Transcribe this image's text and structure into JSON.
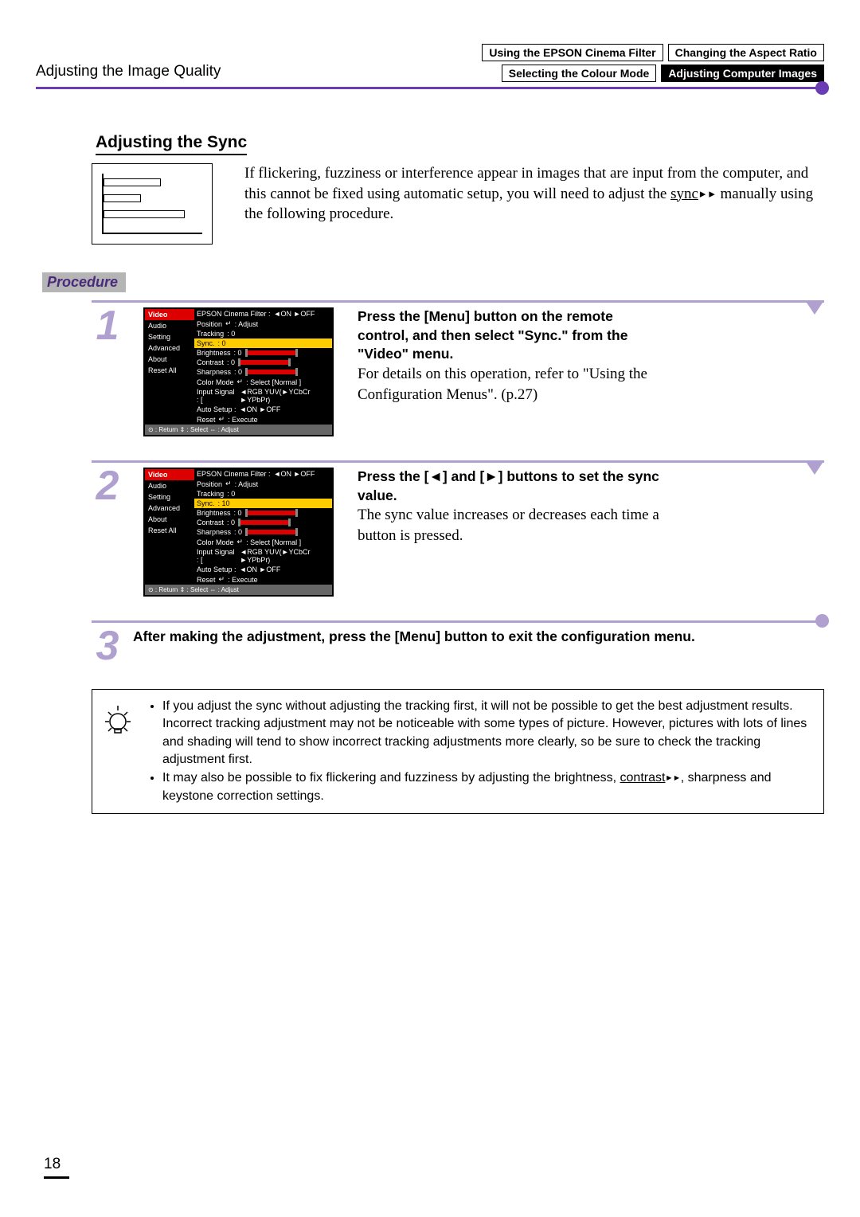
{
  "header": {
    "left_title": "Adjusting the Image Quality",
    "tab1": "Using the EPSON Cinema Filter",
    "tab2": "Changing the Aspect Ratio",
    "tab3": "Selecting the Colour Mode",
    "tab4": "Adjusting Computer Images"
  },
  "section_title": "Adjusting the Sync",
  "intro_a": "If flickering, fuzziness or interference appear in images that are input from the computer, and this cannot be fixed using automatic setup, you will need to adjust the ",
  "intro_sync": "sync",
  "intro_b": " manually using the following procedure.",
  "procedure_label": "Procedure",
  "menu_sidebar": {
    "video": "Video",
    "audio": "Audio",
    "setting": "Setting",
    "advanced": "Advanced",
    "about": "About",
    "reset_all": "Reset All"
  },
  "menu_rows": {
    "filter": "EPSON Cinema Filter :",
    "filter_val": "◄ON  ►OFF",
    "position": "Position",
    "position_val": ": Adjust",
    "tracking": "Tracking",
    "tracking_val": ":       0",
    "sync": "Sync.",
    "sync_val0": ":       0",
    "sync_val10": ":      10",
    "brightness": "Brightness",
    "brightness_val": ":     0",
    "contrast": "Contrast",
    "contrast_val": ":     0",
    "sharpness": "Sharpness",
    "sharpness_val": ":     0",
    "colormode": "Color Mode",
    "colormode_val": ": Select  [Normal      ]",
    "inputsig": "Input Signal : [",
    "inputsig_val": "◄RGB  YUV(►YCbCr ►YPbPr)",
    "autosetup": "Auto Setup  :",
    "autosetup_val": "◄ON  ►OFF",
    "reset": "Reset",
    "reset_val": ": Execute",
    "enter": "↵"
  },
  "menu_footer": "⊙ : Return  ⇕ : Select  ⇔ : Adjust",
  "step1": {
    "num": "1",
    "bold": "Press the [Menu] button on the remote control, and then select \"Sync.\" from the \"Video\" menu.",
    "serif": "For details on this operation, refer to \"Using the Configuration Menus\". (p.27)"
  },
  "step2": {
    "num": "2",
    "bold_a": "Press the [",
    "tri_l": "◄",
    "bold_b": "] and [",
    "tri_r": "►",
    "bold_c": "] buttons to set the sync value.",
    "serif": "The sync value increases or decreases each time a button is pressed."
  },
  "step3": {
    "num": "3",
    "text": "After making the adjustment, press the [Menu] button to exit the configuration menu."
  },
  "tips": {
    "t1": "If you adjust the sync without adjusting the tracking first, it will not be possible to get the best adjustment results. Incorrect tracking adjustment may not be noticeable with some types of picture. However, pictures with lots of lines and shading will tend to show incorrect tracking adjustments more clearly, so be sure to check the tracking adjustment first.",
    "t2a": "It may also be possible to fix flickering and fuzziness by adjusting the brightness, ",
    "t2_contrast": "contrast",
    "t2b": ", sharpness and keystone correction settings."
  },
  "page_number": "18"
}
